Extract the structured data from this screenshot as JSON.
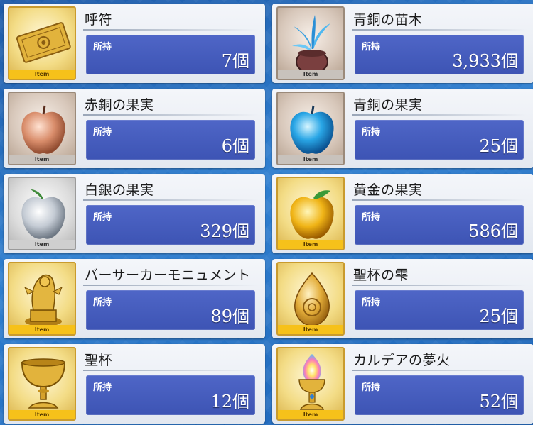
{
  "items": [
    {
      "name": "呼符",
      "label": "所持",
      "count": "7個",
      "tag": "Item",
      "icon": "summon-ticket-icon",
      "frame": "gold"
    },
    {
      "name": "青銅の苗木",
      "label": "所持",
      "count": "3,933個",
      "tag": "Item",
      "icon": "bronze-sapling-icon",
      "frame": "bronze"
    },
    {
      "name": "赤銅の果実",
      "label": "所持",
      "count": "6個",
      "tag": "Item",
      "icon": "copper-fruit-icon",
      "frame": "bronze"
    },
    {
      "name": "青銅の果実",
      "label": "所持",
      "count": "25個",
      "tag": "Item",
      "icon": "bronze-fruit-icon",
      "frame": "bronze"
    },
    {
      "name": "白銀の果実",
      "label": "所持",
      "count": "329個",
      "tag": "Item",
      "icon": "silver-fruit-icon",
      "frame": "silver"
    },
    {
      "name": "黄金の果実",
      "label": "所持",
      "count": "586個",
      "tag": "Item",
      "icon": "golden-fruit-icon",
      "frame": "gold"
    },
    {
      "name": "バーサーカーモニュメント",
      "label": "所持",
      "count": "89個",
      "tag": "Item",
      "icon": "berserker-monument-icon",
      "frame": "gold"
    },
    {
      "name": "聖杯の雫",
      "label": "所持",
      "count": "25個",
      "tag": "Item",
      "icon": "grail-droplet-icon",
      "frame": "gold"
    },
    {
      "name": "聖杯",
      "label": "所持",
      "count": "12個",
      "tag": "Item",
      "icon": "holy-grail-icon",
      "frame": "gold"
    },
    {
      "name": "カルデアの夢火",
      "label": "所持",
      "count": "52個",
      "tag": "Item",
      "icon": "chaldea-lantern-icon",
      "frame": "gold"
    }
  ]
}
